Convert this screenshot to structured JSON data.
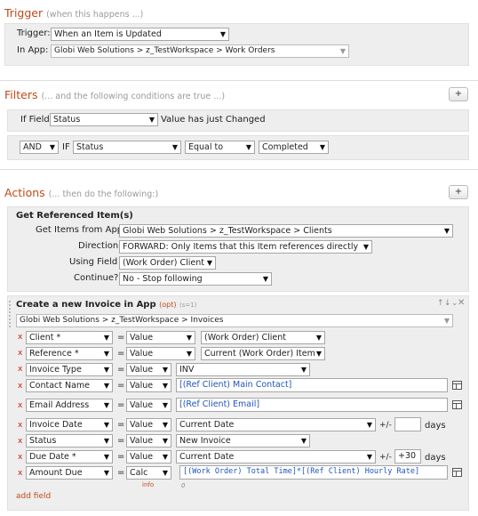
{
  "trigger": {
    "title": "Trigger",
    "note": "(when this happens ...)",
    "trigger_label": "Trigger:",
    "trigger_value": "When an Item is Updated",
    "app_label": "In App:",
    "app_value": "Globi Web Solutions > z_TestWorkspace > Work Orders"
  },
  "filters": {
    "title": "Filters",
    "note": "(... and the following conditions are true ...)",
    "add_label": "+",
    "row1": {
      "if_label": "If Field",
      "field": "Status",
      "condition": "Value has just Changed"
    },
    "row2": {
      "conj": "AND",
      "if_label": "IF",
      "field": "Status",
      "op": "Equal to",
      "value": "Completed"
    }
  },
  "actions": {
    "title": "Actions",
    "note": "(... then do the following:)",
    "add_label": "+",
    "ref": {
      "title": "Get Referenced Item(s)",
      "get_items_label": "Get Items from App",
      "get_items_value": "Globi Web Solutions > z_TestWorkspace > Clients",
      "direction_label": "Direction",
      "direction_value": "FORWARD: Only Items that this Item references directly",
      "using_label": "Using Field",
      "using_value": "(Work Order) Client",
      "continue_label": "Continue?",
      "continue_value": "No - Stop following"
    },
    "create": {
      "title": "Create a new Invoice in App",
      "opt": "(opt)",
      "id": "(s=1)",
      "app_value": "Globi Web Solutions > z_TestWorkspace > Invoices",
      "remove": "x",
      "equals": "=",
      "pm": "+/-",
      "days": "days",
      "info": "info",
      "cursor": "0",
      "fields": [
        {
          "field": "Client *",
          "mode": "Value",
          "value": "(Work Order) Client"
        },
        {
          "field": "Reference *",
          "mode": "Value",
          "value": "Current (Work Order) Item"
        },
        {
          "field": "Invoice Type",
          "mode": "Value",
          "value": "INV"
        },
        {
          "field": "Contact Name",
          "mode": "Value",
          "value": "[(Ref Client) Main Contact]"
        },
        {
          "field": "Email Address",
          "mode": "Value",
          "value": "[(Ref Client) Email]"
        },
        {
          "field": "Invoice Date",
          "mode": "Value",
          "value": "Current Date",
          "offset": ""
        },
        {
          "field": "Status",
          "mode": "Value",
          "value": "New Invoice"
        },
        {
          "field": "Due Date *",
          "mode": "Value",
          "value": "Current Date",
          "offset": "+30"
        },
        {
          "field": "Amount Due",
          "mode": "Calc",
          "value": "[(Work Order) Total Time]*[(Ref Client) Hourly Rate]"
        }
      ],
      "add_field": "add field"
    }
  }
}
